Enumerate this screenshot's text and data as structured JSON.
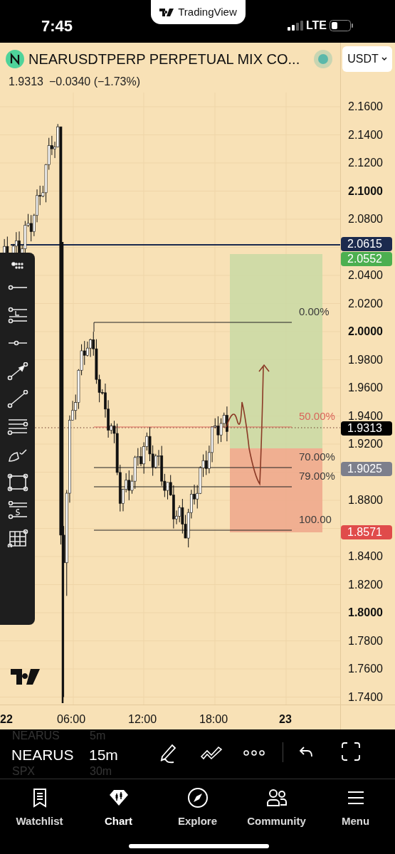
{
  "status_bar": {
    "time": "7:45",
    "app_pill": "TradingView",
    "network": "LTE"
  },
  "header": {
    "symbol": "NEARUSDTPERP PERPETUAL MIX CO...",
    "price": "1.9313",
    "change": "−0.0340 (−1.73%)",
    "currency": "USDT"
  },
  "price_axis": {
    "ticks": [
      {
        "label": "2.1600",
        "bold": false
      },
      {
        "label": "2.1400",
        "bold": false
      },
      {
        "label": "2.1200",
        "bold": false
      },
      {
        "label": "2.1000",
        "bold": true
      },
      {
        "label": "2.0800",
        "bold": false
      },
      {
        "label": "2.0400",
        "bold": false
      },
      {
        "label": "2.0200",
        "bold": false
      },
      {
        "label": "2.0000",
        "bold": true
      },
      {
        "label": "1.9800",
        "bold": false
      },
      {
        "label": "1.9600",
        "bold": false
      },
      {
        "label": "1.9400",
        "bold": false
      },
      {
        "label": "1.9200",
        "bold": false
      },
      {
        "label": "1.8800",
        "bold": false
      },
      {
        "label": "1.8400",
        "bold": false
      },
      {
        "label": "1.8200",
        "bold": false
      },
      {
        "label": "1.8000",
        "bold": true
      },
      {
        "label": "1.7800",
        "bold": false
      },
      {
        "label": "1.7600",
        "bold": false
      },
      {
        "label": "1.7400",
        "bold": false
      }
    ],
    "tags": [
      {
        "label": "2.0615",
        "color": "#1b2a4e"
      },
      {
        "label": "2.0552",
        "color": "#4caf50"
      },
      {
        "label": "1.9313",
        "color": "#000000"
      },
      {
        "label": "1.9025",
        "color": "#7d7f8c"
      },
      {
        "label": "1.8571",
        "color": "#e04b4b"
      }
    ]
  },
  "fib_levels": [
    {
      "label": "0.00%",
      "color": "#3b3b3b"
    },
    {
      "label": "50.00%",
      "color": "#d9645a"
    },
    {
      "label": "70.00%",
      "color": "#3b3b3b"
    },
    {
      "label": "79.00%",
      "color": "#3b3b3b"
    },
    {
      "label": "100.00",
      "color": "#3b3b3b"
    }
  ],
  "time_axis": [
    {
      "label": "22",
      "bold": true
    },
    {
      "label": "06:00",
      "bold": false
    },
    {
      "label": "12:00",
      "bold": false
    },
    {
      "label": "18:00",
      "bold": false
    },
    {
      "label": "23",
      "bold": true
    }
  ],
  "toolbar": {
    "symbol_above": "NEARUS",
    "interval_above": "5m",
    "symbol": "NEARUS",
    "interval": "15m",
    "symbol_below": "SPX",
    "interval_below": "30m"
  },
  "tabs": [
    {
      "label": "Watchlist",
      "selected": false
    },
    {
      "label": "Chart",
      "selected": true
    },
    {
      "label": "Explore",
      "selected": false
    },
    {
      "label": "Community",
      "selected": false
    },
    {
      "label": "Menu",
      "selected": false
    }
  ]
}
